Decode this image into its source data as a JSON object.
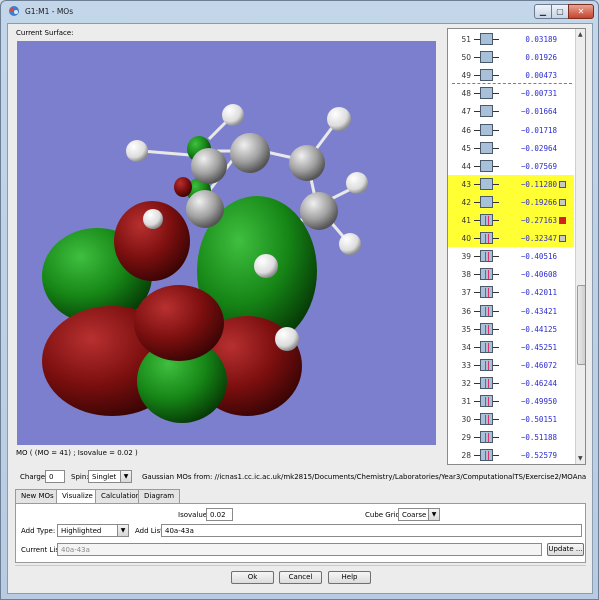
{
  "window": {
    "title": "G1:M1 - MOs",
    "min_icon": "minimize-icon",
    "max_icon": "maximize-icon",
    "close_icon": "close-icon"
  },
  "viewer": {
    "label": "Current Surface:",
    "status": "MO ( (MO = 41) ; Isovalue = 0.02 )",
    "background": "#7b7fce"
  },
  "mo_list": [
    {
      "num": "51",
      "energy": "0.03189",
      "occupied": false,
      "highlighted": false,
      "mark": ""
    },
    {
      "num": "50",
      "energy": "0.01926",
      "occupied": false,
      "highlighted": false,
      "mark": ""
    },
    {
      "num": "49",
      "energy": "0.00473",
      "occupied": false,
      "highlighted": false,
      "mark": ""
    },
    {
      "num": "48",
      "energy": "−0.00731",
      "occupied": false,
      "highlighted": false,
      "mark": ""
    },
    {
      "num": "47",
      "energy": "−0.01664",
      "occupied": false,
      "highlighted": false,
      "mark": ""
    },
    {
      "num": "46",
      "energy": "−0.01718",
      "occupied": false,
      "highlighted": false,
      "mark": ""
    },
    {
      "num": "45",
      "energy": "−0.02964",
      "occupied": false,
      "highlighted": false,
      "mark": ""
    },
    {
      "num": "44",
      "energy": "−0.07569",
      "occupied": false,
      "highlighted": false,
      "mark": ""
    },
    {
      "num": "43",
      "energy": "−0.11280",
      "occupied": false,
      "highlighted": true,
      "mark": "#c8c8c8"
    },
    {
      "num": "42",
      "energy": "−0.19266",
      "occupied": false,
      "highlighted": true,
      "mark": "#c8c8c8"
    },
    {
      "num": "41",
      "energy": "−0.27163",
      "occupied": true,
      "highlighted": true,
      "mark": "#d42020"
    },
    {
      "num": "40",
      "energy": "−0.32347",
      "occupied": true,
      "highlighted": true,
      "mark": "#c8c8c8"
    },
    {
      "num": "39",
      "energy": "−0.40516",
      "occupied": true,
      "highlighted": false,
      "mark": ""
    },
    {
      "num": "38",
      "energy": "−0.40608",
      "occupied": true,
      "highlighted": false,
      "mark": ""
    },
    {
      "num": "37",
      "energy": "−0.42011",
      "occupied": true,
      "highlighted": false,
      "mark": ""
    },
    {
      "num": "36",
      "energy": "−0.43421",
      "occupied": true,
      "highlighted": false,
      "mark": ""
    },
    {
      "num": "35",
      "energy": "−0.44125",
      "occupied": true,
      "highlighted": false,
      "mark": ""
    },
    {
      "num": "34",
      "energy": "−0.45251",
      "occupied": true,
      "highlighted": false,
      "mark": ""
    },
    {
      "num": "33",
      "energy": "−0.46072",
      "occupied": true,
      "highlighted": false,
      "mark": ""
    },
    {
      "num": "32",
      "energy": "−0.46244",
      "occupied": true,
      "highlighted": false,
      "mark": ""
    },
    {
      "num": "31",
      "energy": "−0.49950",
      "occupied": true,
      "highlighted": false,
      "mark": ""
    },
    {
      "num": "30",
      "energy": "−0.50151",
      "occupied": true,
      "highlighted": false,
      "mark": ""
    },
    {
      "num": "29",
      "energy": "−0.51188",
      "occupied": true,
      "highlighted": false,
      "mark": ""
    },
    {
      "num": "28",
      "energy": "−0.52579",
      "occupied": true,
      "highlighted": false,
      "mark": ""
    }
  ],
  "info": {
    "charge_label": "Charge:",
    "charge_value": "0",
    "spin_label": "Spin:",
    "spin_value": "Singlet",
    "source_text": "Gaussian MOs from: //icnas1.cc.ic.ac.uk/mk2815/Documents/Chemistry/Laboratories/Year3/ComputationalTS/Exercise2/MOAnalysis/ENDO.c"
  },
  "tabs": [
    {
      "label": "New MOs",
      "active": false
    },
    {
      "label": "Visualize",
      "active": true
    },
    {
      "label": "Calculation",
      "active": false
    },
    {
      "label": "Diagram",
      "active": false
    }
  ],
  "visualize": {
    "isovalue_label": "Isovalue:",
    "isovalue_value": "0.02",
    "cube_label": "Cube Grid:",
    "cube_value": "Coarse",
    "add_type_label": "Add Type:",
    "add_type_value": "Highlighted",
    "add_list_label": "Add List:",
    "add_list_value": "40a-43a",
    "current_list_label": "Current List:",
    "current_list_value": "40a-43a",
    "update_label": "Update ..."
  },
  "footer": {
    "ok": "Ok",
    "cancel": "Cancel",
    "help": "Help"
  },
  "colors": {
    "highlight": "#ffff33",
    "energy": "#2b2bd0",
    "homo_line": "#2fb52f",
    "lobe_green": "#1c8a1c",
    "lobe_red": "#8b1414"
  }
}
